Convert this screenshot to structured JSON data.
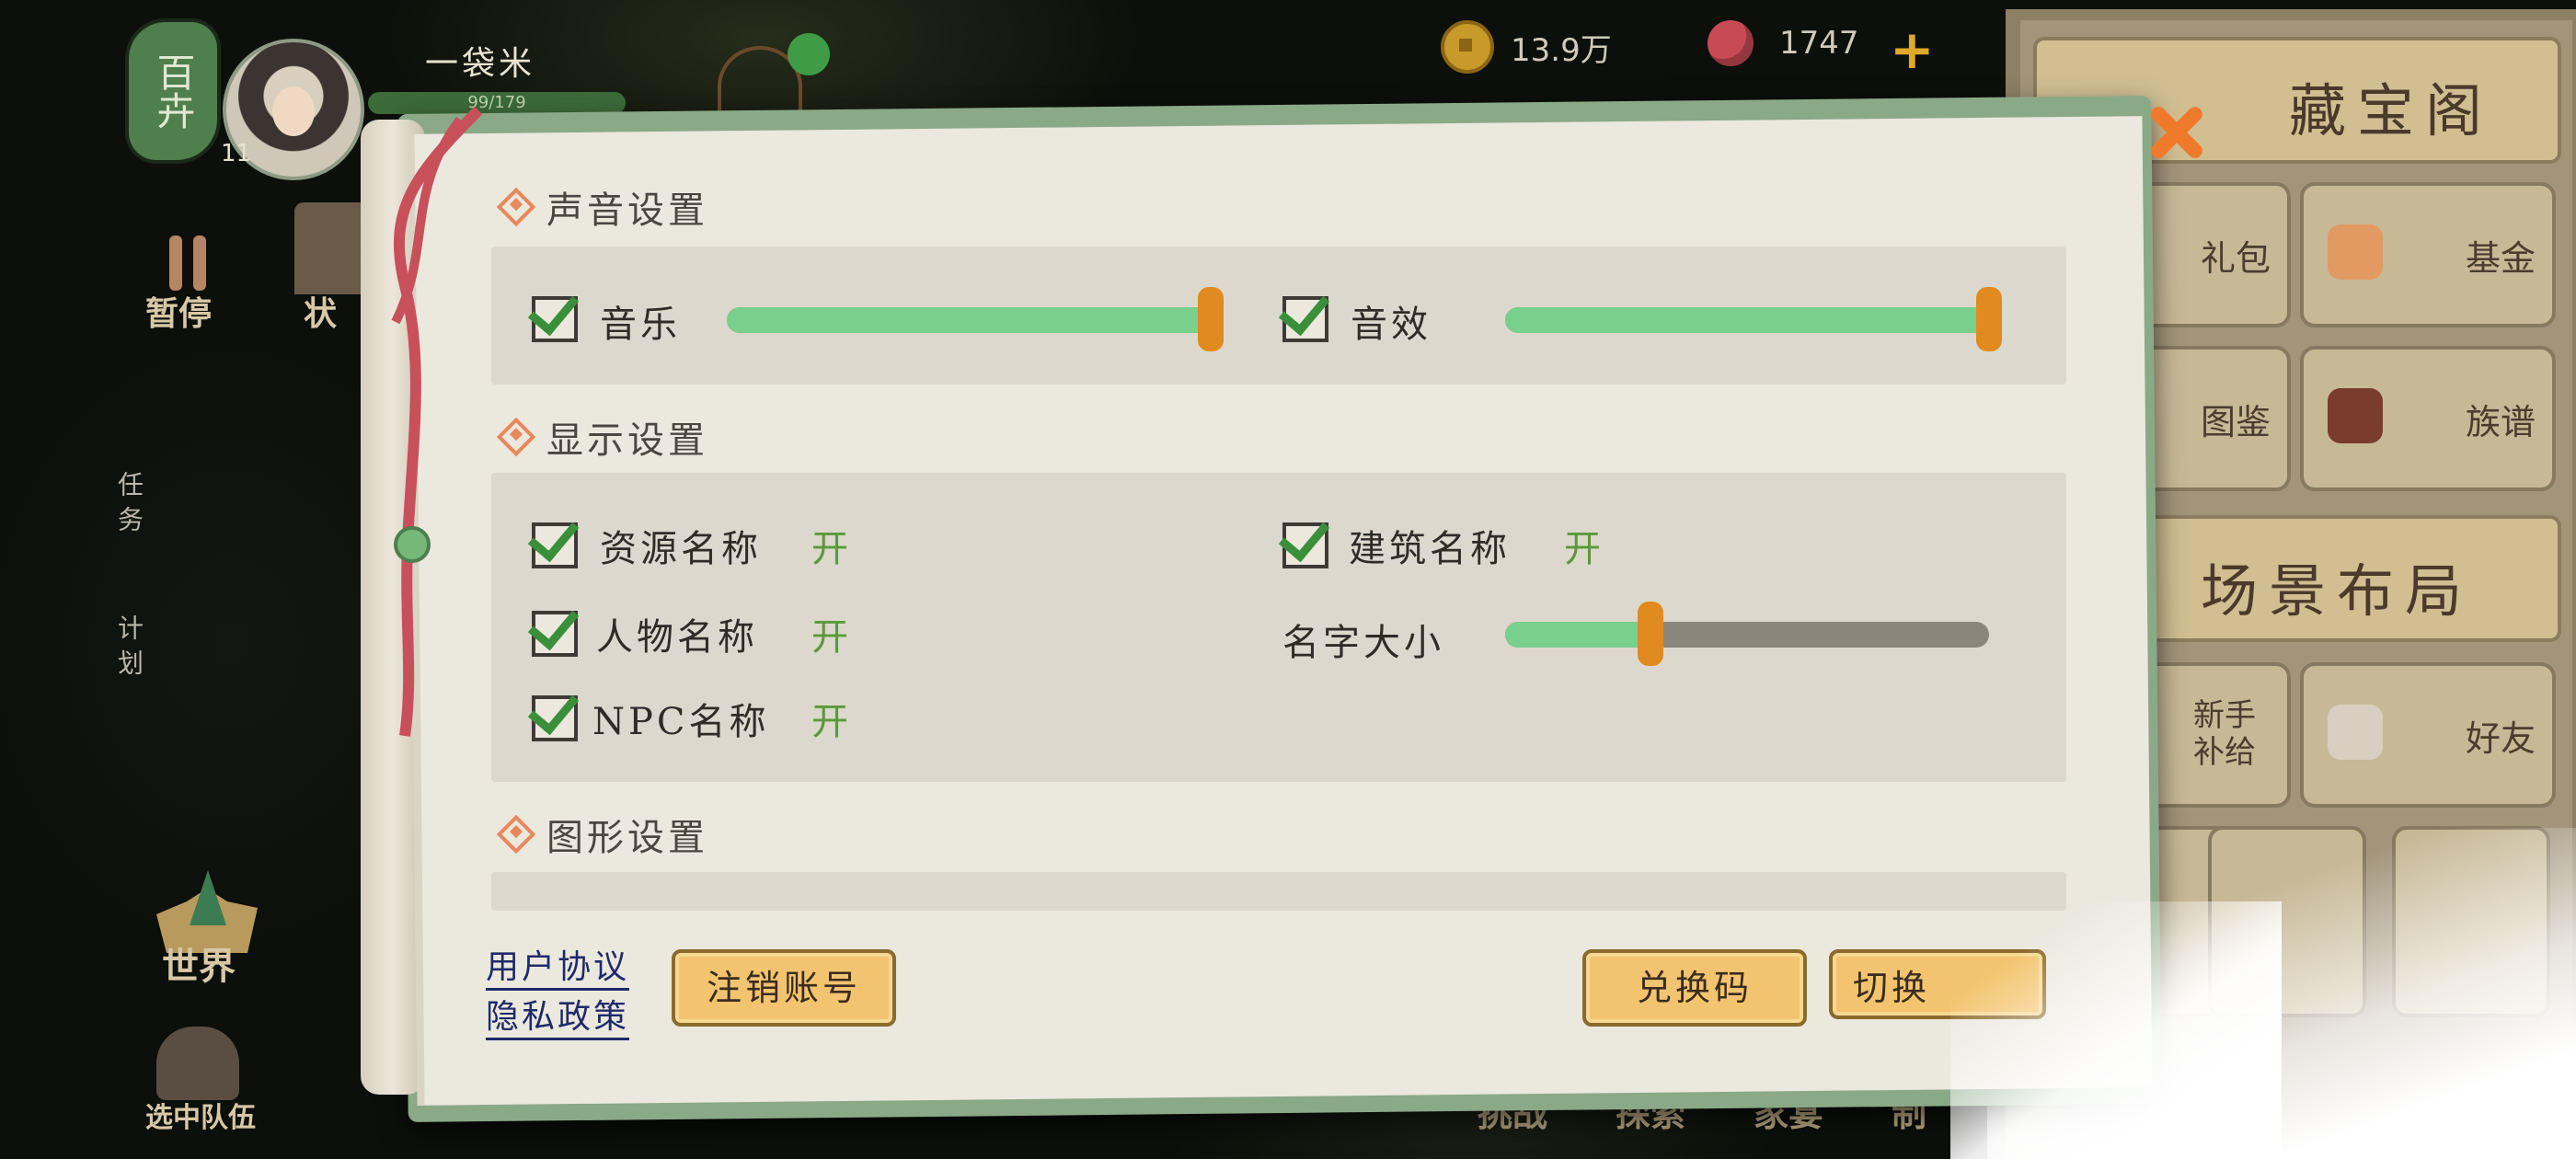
{
  "hud": {
    "clan_badge": "百卉",
    "clan_level": "11",
    "player_name": "一袋米",
    "exp_text": "99/179",
    "coins": "13.9万",
    "gems": "1747"
  },
  "left_menu": {
    "pause": "暂停",
    "status": "状",
    "task": "任务",
    "plan": "计划",
    "world": "世界",
    "team": "选中队伍"
  },
  "bottom_nav": [
    "挑战",
    "探索",
    "家宴",
    "制"
  ],
  "right_panel": {
    "treasure": "藏宝阁",
    "gift": "礼包",
    "fund": "基金",
    "atlas": "图鉴",
    "genealogy": "族谱",
    "scene_layout": "场景布局",
    "newbie": "新手补给",
    "friends": "好友"
  },
  "settings": {
    "sound_section": "声音设置",
    "music_label": "音乐",
    "music_level": 1.0,
    "sfx_label": "音效",
    "sfx_level": 1.0,
    "display_section": "显示设置",
    "resource_name_label": "资源名称",
    "resource_name_state": "开",
    "building_name_label": "建筑名称",
    "building_name_state": "开",
    "character_name_label": "人物名称",
    "character_name_state": "开",
    "npc_name_label": "NPC名称",
    "npc_name_state": "开",
    "name_size_label": "名字大小",
    "name_size_level": 0.3,
    "graphics_section": "图形设置",
    "user_agreement": "用户协议",
    "privacy_policy": "隐私政策",
    "cancel_account": "注销账号",
    "redeem_code": "兑换码",
    "switch_account": "切换"
  },
  "colors": {
    "slider_fill": "#79cf8c",
    "slider_knob": "#e08a1f",
    "checkmark": "#3a8f3b",
    "accent_orange": "#ef7a2c",
    "button_fill": "#f3c46f"
  }
}
